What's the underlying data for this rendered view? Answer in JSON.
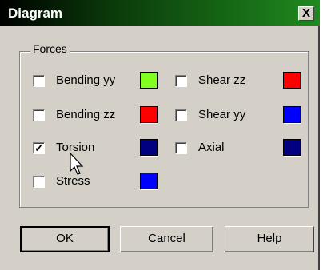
{
  "window": {
    "title": "Diagram",
    "close_label": "X"
  },
  "forces": {
    "group_label": "Forces",
    "items": [
      {
        "label": "Bending yy",
        "checked": false,
        "color": "#80ff20"
      },
      {
        "label": "Shear zz",
        "checked": false,
        "color": "#ff0000"
      },
      {
        "label": "Bending zz",
        "checked": false,
        "color": "#ff0000"
      },
      {
        "label": "Shear yy",
        "checked": false,
        "color": "#0000ff"
      },
      {
        "label": "Torsion",
        "checked": true,
        "color": "#000080"
      },
      {
        "label": "Axial",
        "checked": false,
        "color": "#000080"
      },
      {
        "label": "Stress",
        "checked": false,
        "color": "#0000ff"
      }
    ]
  },
  "buttons": {
    "ok": "OK",
    "cancel": "Cancel",
    "help": "Help"
  },
  "cursor_icon": "arrow-pointer-icon"
}
